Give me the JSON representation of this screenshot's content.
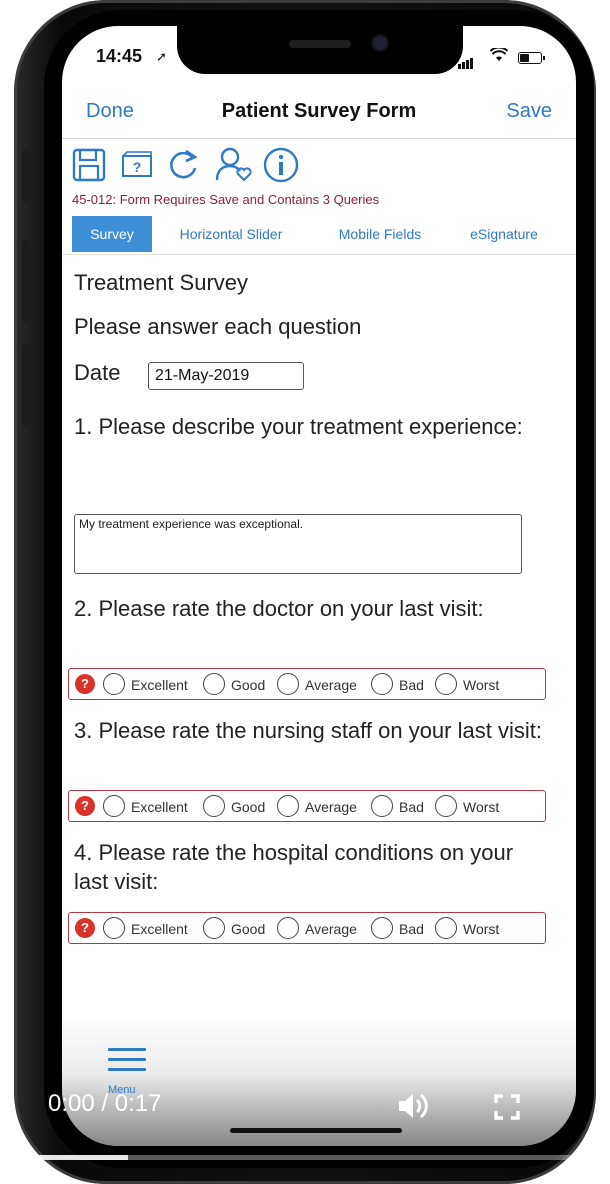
{
  "status_bar": {
    "time": "14:45"
  },
  "navbar": {
    "done_label": "Done",
    "title": "Patient Survey Form",
    "save_label": "Save"
  },
  "toolbar": {
    "icons": [
      "save-icon",
      "help-query-icon",
      "refresh-icon",
      "user-heart-icon",
      "info-icon"
    ]
  },
  "query_message": "45-012: Form Requires Save and Contains 3 Queries",
  "tabs": [
    {
      "label": "Survey",
      "active": true
    },
    {
      "label": "Horizontal Slider",
      "active": false
    },
    {
      "label": "Mobile Fields",
      "active": false
    },
    {
      "label": "eSignature",
      "active": false
    }
  ],
  "form": {
    "title": "Treatment Survey",
    "subtitle": "Please answer each question",
    "date_label": "Date",
    "date_value": "21-May-2019",
    "q1": "1. Please describe your treatment experience:",
    "q1_answer": "My treatment experience was exceptional.",
    "q2": "2. Please rate the doctor on your last visit:",
    "q3": "3. Please rate the nursing staff on your last visit:",
    "q4": "4. Please rate the hospital conditions on your last visit:",
    "query_marker": "?",
    "rating_options": [
      "Excellent",
      "Good",
      "Average",
      "Bad",
      "Worst"
    ]
  },
  "bottom_bar": {
    "menu_label": "Menu"
  },
  "video": {
    "time_display": "0:00 / 0:17",
    "progress_fraction": 0.21
  },
  "colors": {
    "accent_blue": "#2f7ac4",
    "active_tab": "#3e8fd6",
    "query_red": "#d9322a",
    "query_text": "#8b2234"
  }
}
